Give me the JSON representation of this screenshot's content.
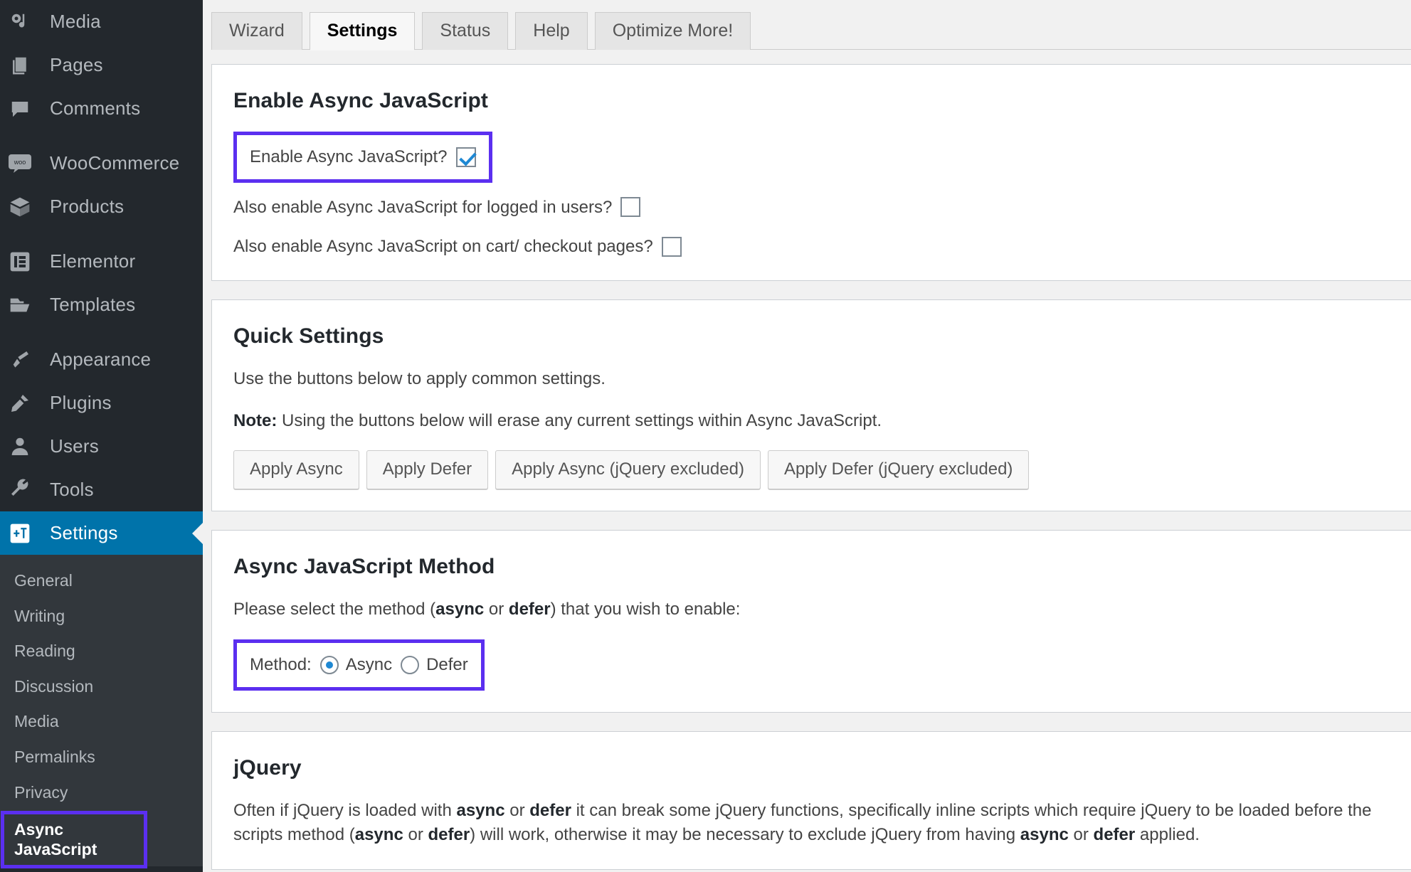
{
  "sidebar": {
    "items": [
      {
        "label": "Media",
        "icon": "media-icon"
      },
      {
        "label": "Pages",
        "icon": "pages-icon"
      },
      {
        "label": "Comments",
        "icon": "comments-icon"
      },
      {
        "label": "WooCommerce",
        "icon": "woocommerce-icon"
      },
      {
        "label": "Products",
        "icon": "products-icon"
      },
      {
        "label": "Elementor",
        "icon": "elementor-icon"
      },
      {
        "label": "Templates",
        "icon": "templates-icon"
      },
      {
        "label": "Appearance",
        "icon": "appearance-icon"
      },
      {
        "label": "Plugins",
        "icon": "plugins-icon"
      },
      {
        "label": "Users",
        "icon": "users-icon"
      },
      {
        "label": "Tools",
        "icon": "tools-icon"
      },
      {
        "label": "Settings",
        "icon": "settings-icon"
      }
    ],
    "active_item": "Settings",
    "submenu": [
      {
        "label": "General"
      },
      {
        "label": "Writing"
      },
      {
        "label": "Reading"
      },
      {
        "label": "Discussion"
      },
      {
        "label": "Media"
      },
      {
        "label": "Permalinks"
      },
      {
        "label": "Privacy"
      },
      {
        "label": "Async JavaScript"
      }
    ],
    "current_submenu": "Async JavaScript",
    "colors": {
      "background": "#23282d",
      "submenu_background": "#32373c",
      "active": "#0073aa",
      "highlight": "#5b2ff0"
    }
  },
  "tabs": [
    {
      "label": "Wizard",
      "active": false
    },
    {
      "label": "Settings",
      "active": true
    },
    {
      "label": "Status",
      "active": false
    },
    {
      "label": "Help",
      "active": false
    },
    {
      "label": "Optimize More!",
      "active": false
    }
  ],
  "panels": {
    "enable": {
      "title": "Enable Async JavaScript",
      "option_enable_label": "Enable Async JavaScript?",
      "option_enable_checked": true,
      "option_logged_in_label": "Also enable Async JavaScript for logged in users?",
      "option_logged_in_checked": false,
      "option_cart_label": "Also enable Async JavaScript on cart/ checkout pages?",
      "option_cart_checked": false
    },
    "quick": {
      "title": "Quick Settings",
      "intro": "Use the buttons below to apply common settings.",
      "note_label": "Note:",
      "note_text": " Using the buttons below will erase any current settings within Async JavaScript.",
      "buttons": [
        "Apply Async",
        "Apply Defer",
        "Apply Async (jQuery excluded)",
        "Apply Defer (jQuery excluded)"
      ]
    },
    "method": {
      "title": "Async JavaScript Method",
      "intro_pre": "Please select the method (",
      "intro_async": "async",
      "intro_mid": " or ",
      "intro_defer": "defer",
      "intro_post": ") that you wish to enable:",
      "method_label": "Method:",
      "option_async": "Async",
      "option_defer": "Defer",
      "selected": "Async"
    },
    "jquery": {
      "title": "jQuery",
      "body_1": "Often if jQuery is loaded with ",
      "body_b1": "async",
      "body_2": " or ",
      "body_b2": "defer",
      "body_3": " it can break some jQuery functions, specifically inline scripts which require jQuery to be loaded before the scripts",
      "body_4": "method (",
      "body_b3": "async",
      "body_5": " or ",
      "body_b4": "defer",
      "body_6": ") will work, otherwise it may be necessary to exclude jQuery from having ",
      "body_b5": "async",
      "body_7": " or ",
      "body_b6": "defer",
      "body_8": " applied."
    }
  }
}
